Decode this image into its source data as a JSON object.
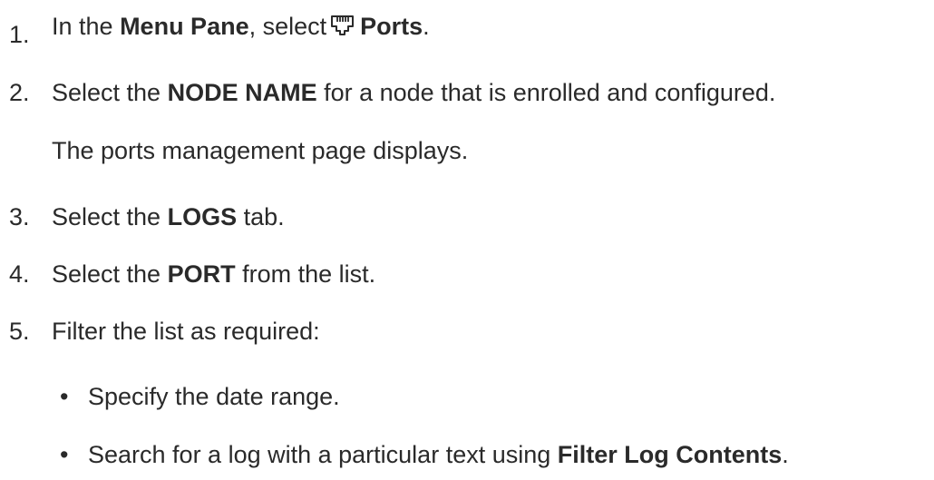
{
  "steps": [
    {
      "number": "1.",
      "before": "In the ",
      "bold1": "Menu Pane",
      "middle": ", select",
      "icon": "ethernet-port-icon",
      "bold2": "Ports",
      "after": "."
    },
    {
      "number": "2.",
      "before": "Select the ",
      "bold1": "NODE NAME",
      "after": " for a node that is enrolled and configured.",
      "note": "The ports management page displays."
    },
    {
      "number": "3.",
      "before": "Select the ",
      "bold1": "LOGS",
      "after": " tab."
    },
    {
      "number": "4.",
      "before": "Select the ",
      "bold1": "PORT",
      "after": " from the list."
    },
    {
      "number": "5.",
      "text": "Filter the list as required:",
      "bullets": [
        {
          "marker": "•",
          "text": "Specify the date range."
        },
        {
          "marker": "•",
          "before": "Search for a log with a particular text using ",
          "bold": "Filter Log Contents",
          "after": "."
        }
      ]
    }
  ]
}
